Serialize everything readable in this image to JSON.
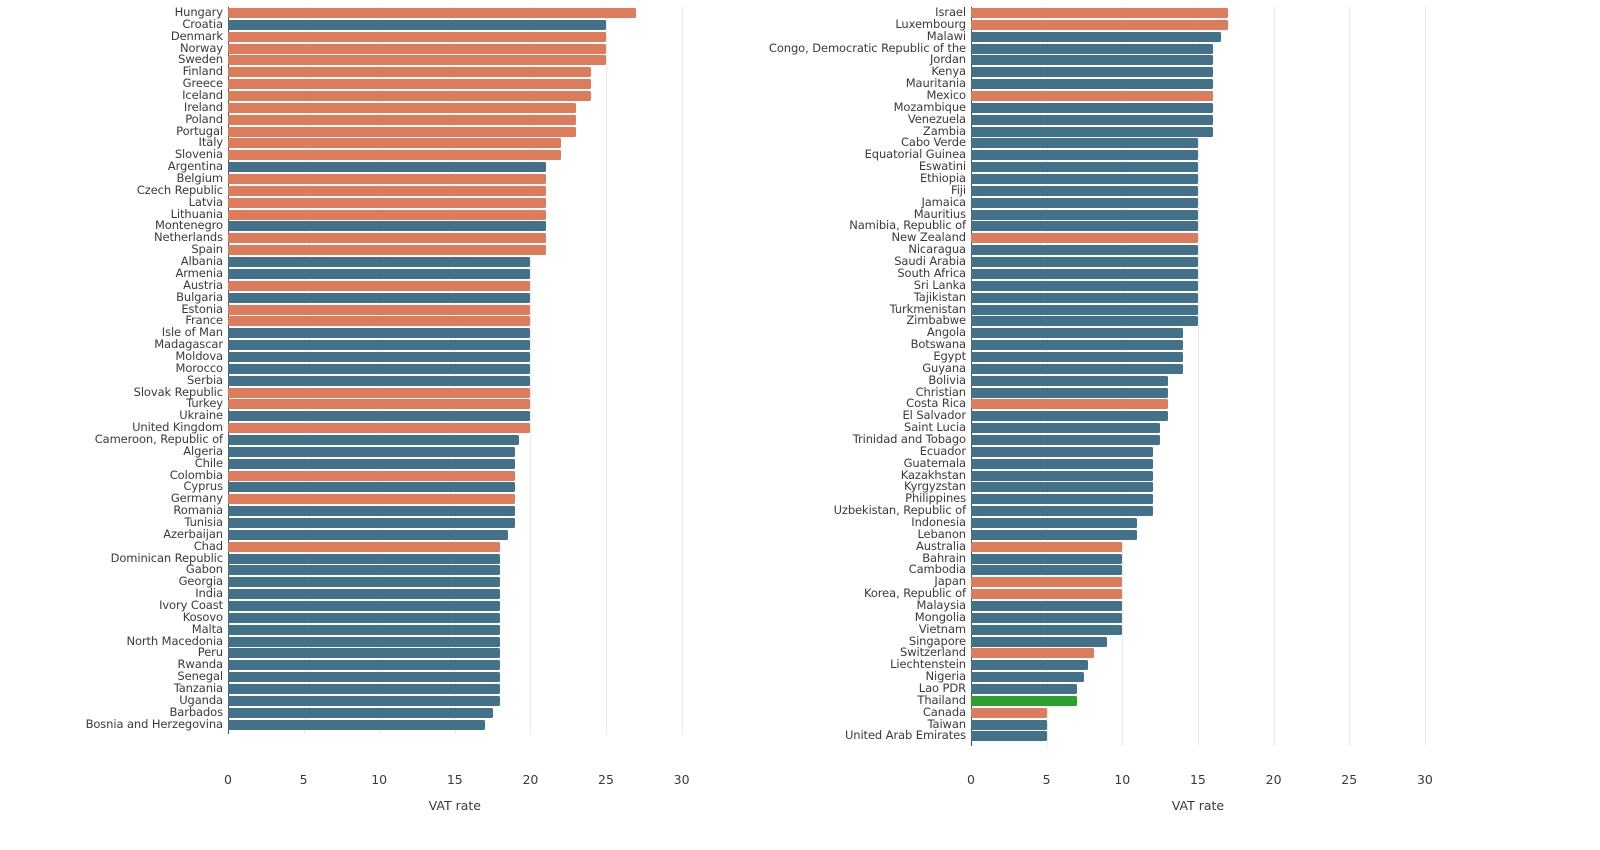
{
  "chart_data": {
    "type": "bar",
    "orientation": "horizontal",
    "title": "",
    "xlabel": "VAT rate",
    "ylabel": "",
    "xlim": [
      0,
      31
    ],
    "grid": true,
    "legend": "none",
    "colors": {
      "orange": "#dd7b5d",
      "blue": "#43718a",
      "highlight_green": "#2ca02c",
      "axis": "#4a4a4a",
      "grid": "#e9e9e9",
      "text": "#3a3a3a",
      "background": "#ffffff"
    },
    "panels": [
      {
        "name": "left-panel",
        "xlabel": "VAT rate",
        "xticks": [
          0,
          5,
          10,
          15,
          20,
          25,
          30
        ],
        "categories": [
          "Hungary",
          "Croatia",
          "Denmark",
          "Norway",
          "Sweden",
          "Finland",
          "Greece",
          "Iceland",
          "Ireland",
          "Poland",
          "Portugal",
          "Italy",
          "Slovenia",
          "Argentina",
          "Belgium",
          "Czech Republic",
          "Latvia",
          "Lithuania",
          "Montenegro",
          "Netherlands",
          "Spain",
          "Albania",
          "Armenia",
          "Austria",
          "Bulgaria",
          "Estonia",
          "France",
          "Isle of Man",
          "Madagascar",
          "Moldova",
          "Morocco",
          "Serbia",
          "Slovak Republic",
          "Turkey",
          "Ukraine",
          "United Kingdom",
          "Cameroon, Republic of",
          "Algeria",
          "Chile",
          "Colombia",
          "Cyprus",
          "Germany",
          "Romania",
          "Tunisia",
          "Azerbaijan",
          "Chad",
          "Dominican Republic",
          "Gabon",
          "Georgia",
          "India",
          "Ivory Coast",
          "Kosovo",
          "Malta",
          "North Macedonia",
          "Peru",
          "Rwanda",
          "Senegal",
          "Tanzania",
          "Uganda",
          "Barbados",
          "Bosnia and Herzegovina"
        ],
        "values": [
          27,
          25,
          25,
          25,
          25,
          24,
          24,
          24,
          23,
          23,
          23,
          22,
          22,
          21,
          21,
          21,
          21,
          21,
          21,
          21,
          21,
          20,
          20,
          20,
          20,
          20,
          20,
          20,
          20,
          20,
          20,
          20,
          20,
          20,
          20,
          20,
          19.25,
          19,
          19,
          19,
          19,
          19,
          19,
          19,
          18.5,
          18,
          18,
          18,
          18,
          18,
          18,
          18,
          18,
          18,
          18,
          18,
          18,
          18,
          18,
          17.5,
          17
        ],
        "colors": [
          "orange",
          "blue",
          "orange",
          "orange",
          "orange",
          "orange",
          "orange",
          "orange",
          "orange",
          "orange",
          "orange",
          "orange",
          "orange",
          "blue",
          "orange",
          "orange",
          "orange",
          "orange",
          "blue",
          "orange",
          "orange",
          "blue",
          "blue",
          "orange",
          "blue",
          "orange",
          "orange",
          "blue",
          "blue",
          "blue",
          "blue",
          "blue",
          "orange",
          "orange",
          "blue",
          "orange",
          "blue",
          "blue",
          "blue",
          "orange",
          "blue",
          "orange",
          "blue",
          "blue",
          "blue",
          "orange",
          "blue",
          "blue",
          "blue",
          "blue",
          "blue",
          "blue",
          "blue",
          "blue",
          "blue",
          "blue",
          "blue",
          "blue",
          "blue",
          "blue",
          "blue"
        ]
      },
      {
        "name": "right-panel",
        "xlabel": "VAT rate",
        "xticks": [
          0,
          5,
          10,
          15,
          20,
          25,
          30
        ],
        "categories": [
          "Israel",
          "Luxembourg",
          "Malawi",
          "Congo, Democratic Republic of the",
          "Jordan",
          "Kenya",
          "Mauritania",
          "Mexico",
          "Mozambique",
          "Venezuela",
          "Zambia",
          "Cabo Verde",
          "Equatorial Guinea",
          "Eswatini",
          "Ethiopia",
          "Fiji",
          "Jamaica",
          "Mauritius",
          "Namibia, Republic of",
          "New Zealand",
          "Nicaragua",
          "Saudi Arabia",
          "South Africa",
          "Sri Lanka",
          "Tajikistan",
          "Turkmenistan",
          "Zimbabwe",
          "Angola",
          "Botswana",
          "Egypt",
          "Guyana",
          "Bolivia",
          "Christian",
          "Costa Rica",
          "El Salvador",
          "Saint Lucia",
          "Trinidad and Tobago",
          "Ecuador",
          "Guatemala",
          "Kazakhstan",
          "Kyrgyzstan",
          "Philippines",
          "Uzbekistan, Republic of",
          "Indonesia",
          "Lebanon",
          "Australia",
          "Bahrain",
          "Cambodia",
          "Japan",
          "Korea, Republic of",
          "Malaysia",
          "Mongolia",
          "Vietnam",
          "Singapore",
          "Switzerland",
          "Liechtenstein",
          "Nigeria",
          "Lao PDR",
          "Thailand",
          "Canada",
          "Taiwan",
          "United Arab Emirates"
        ],
        "values": [
          17,
          17,
          16.5,
          16,
          16,
          16,
          16,
          16,
          16,
          16,
          16,
          15,
          15,
          15,
          15,
          15,
          15,
          15,
          15,
          15,
          15,
          15,
          15,
          15,
          15,
          15,
          15,
          14,
          14,
          14,
          14,
          13,
          13,
          13,
          13,
          12.5,
          12.5,
          12,
          12,
          12,
          12,
          12,
          12,
          11,
          11,
          10,
          10,
          10,
          10,
          10,
          10,
          10,
          10,
          9,
          8.1,
          7.7,
          7.5,
          7,
          7,
          5,
          5,
          5
        ],
        "colors": [
          "orange",
          "orange",
          "blue",
          "blue",
          "blue",
          "blue",
          "blue",
          "orange",
          "blue",
          "blue",
          "blue",
          "blue",
          "blue",
          "blue",
          "blue",
          "blue",
          "blue",
          "blue",
          "blue",
          "orange",
          "blue",
          "blue",
          "blue",
          "blue",
          "blue",
          "blue",
          "blue",
          "blue",
          "blue",
          "blue",
          "blue",
          "blue",
          "blue",
          "orange",
          "blue",
          "blue",
          "blue",
          "blue",
          "blue",
          "blue",
          "blue",
          "blue",
          "blue",
          "blue",
          "blue",
          "orange",
          "blue",
          "blue",
          "orange",
          "orange",
          "blue",
          "blue",
          "blue",
          "blue",
          "orange",
          "blue",
          "blue",
          "blue",
          "highlight_green",
          "orange",
          "blue",
          "blue"
        ]
      }
    ]
  }
}
